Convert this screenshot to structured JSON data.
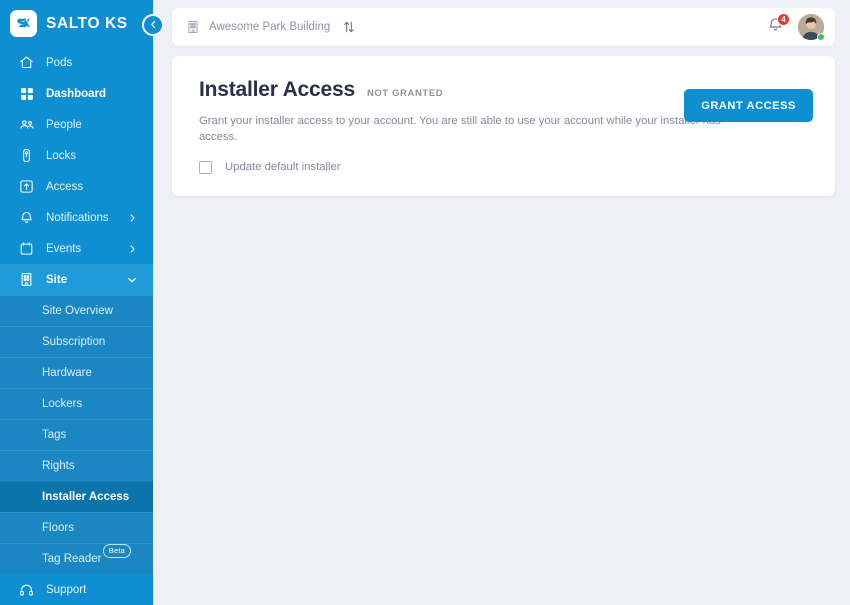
{
  "brand": {
    "name": "SALTO KS",
    "logo_icon": "salto-ks-monogram",
    "accent_color": "#0d8fd1"
  },
  "sidebar": {
    "background_color": "#0d8fd1",
    "submenu_background_color": "#1b87c2",
    "active_item_color": "#0b74ab",
    "items": [
      {
        "label": "Pods",
        "icon": "home-icon",
        "active": false,
        "expandable": false
      },
      {
        "label": "Dashboard",
        "icon": "grid-icon",
        "active": false,
        "expandable": false
      },
      {
        "label": "People",
        "icon": "people-icon",
        "active": false,
        "expandable": false
      },
      {
        "label": "Locks",
        "icon": "lock-icon",
        "active": false,
        "expandable": false
      },
      {
        "label": "Access",
        "icon": "access-icon",
        "active": false,
        "expandable": false
      },
      {
        "label": "Notifications",
        "icon": "bell-icon",
        "active": false,
        "expandable": true,
        "expanded": false
      },
      {
        "label": "Events",
        "icon": "calendar-icon",
        "active": false,
        "expandable": true,
        "expanded": false
      },
      {
        "label": "Site",
        "icon": "building-icon",
        "active": true,
        "expandable": true,
        "expanded": true
      }
    ],
    "submenu": [
      {
        "label": "Site Overview",
        "active": false
      },
      {
        "label": "Subscription",
        "active": false
      },
      {
        "label": "Hardware",
        "active": false
      },
      {
        "label": "Lockers",
        "active": false
      },
      {
        "label": "Tags",
        "active": false
      },
      {
        "label": "Rights",
        "active": false
      },
      {
        "label": "Installer Access",
        "active": true
      },
      {
        "label": "Floors",
        "active": false
      },
      {
        "label": "Tag Reader",
        "active": false,
        "badge": "Beta"
      }
    ],
    "support": {
      "label": "Support",
      "icon": "headset-icon"
    },
    "collapse_button": {
      "icon": "chevron-left-icon"
    }
  },
  "topbar": {
    "site_icon": "building-icon",
    "site_name": "Awesome Park Building",
    "switch_site_icon": "sort-arrows-icon",
    "notifications": {
      "icon": "bell-icon",
      "count": "4",
      "badge_color": "#e8392f"
    },
    "avatar": {
      "icon": "user-avatar",
      "status": "online",
      "status_color": "#35c759"
    }
  },
  "card": {
    "title": "Installer Access",
    "status": "NOT GRANTED",
    "description": "Grant your installer access to your account. You are still able to use your account while your installer has access.",
    "checkbox": {
      "label": "Update default installer",
      "checked": false
    },
    "primary_action": {
      "label": "GRANT ACCESS",
      "color": "#0d8fd1"
    }
  }
}
